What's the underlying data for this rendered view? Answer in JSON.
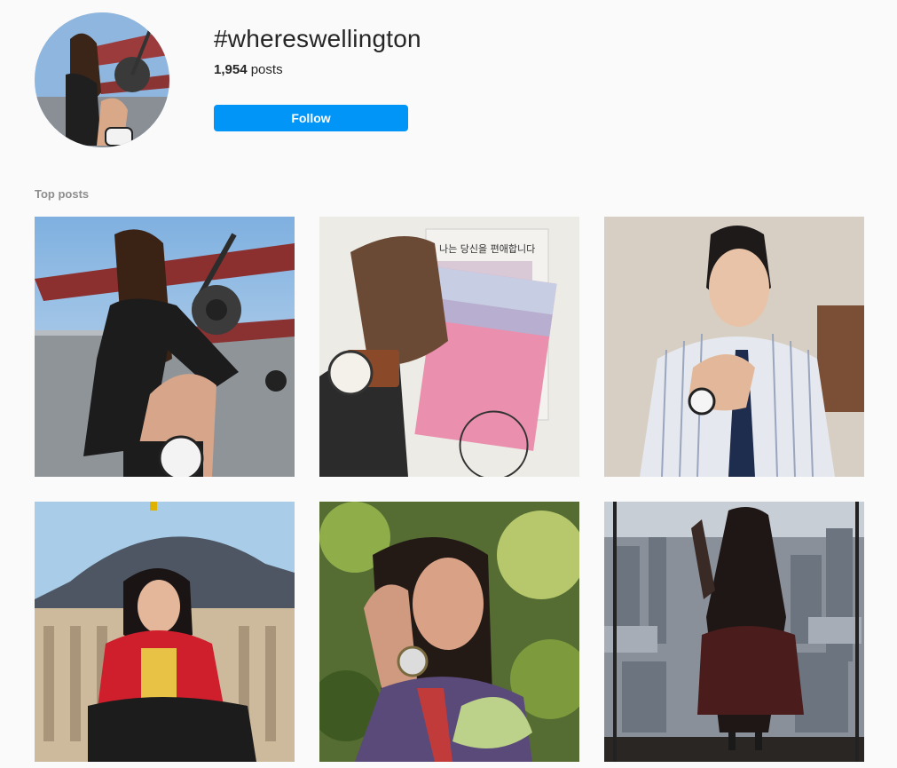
{
  "hashtag": {
    "title": "#whereswellington",
    "post_count": "1,954",
    "post_label": "posts",
    "follow_label": "Follow"
  },
  "sections": {
    "top_posts_label": "Top posts"
  },
  "posts": [
    {
      "subject": "woman leading by hand toward biplane, wearing watch"
    },
    {
      "subject": "hand with watch holding Korean books",
      "book_title": "나는 당신을 편애합니다"
    },
    {
      "subject": "man in striped shirt adjusting tie, wearing watch"
    },
    {
      "subject": "woman in red jacket sitting in front of palace"
    },
    {
      "subject": "woman among leaves touching hair, wearing watch"
    },
    {
      "subject": "woman waving at window overlooking city"
    }
  ],
  "colors": {
    "follow_blue": "#0095f6",
    "background": "#fafafa",
    "muted_text": "#8e8e8e"
  }
}
